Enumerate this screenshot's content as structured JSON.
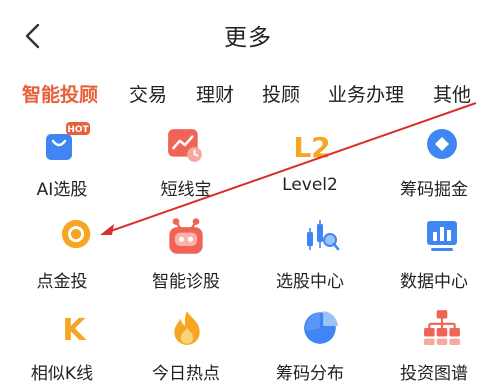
{
  "header": {
    "title": "更多",
    "back_icon": "chevron-left-icon"
  },
  "tabs": [
    {
      "label": "智能投顾",
      "active": true
    },
    {
      "label": "交易",
      "active": false
    },
    {
      "label": "理财",
      "active": false
    },
    {
      "label": "投顾",
      "active": false
    },
    {
      "label": "业务办理",
      "active": false
    },
    {
      "label": "其他",
      "active": false
    }
  ],
  "grid": [
    {
      "label": "AI选股",
      "icon": "shopping-bag-icon",
      "badge": "HOT"
    },
    {
      "label": "短线宝",
      "icon": "trend-chart-clock-icon"
    },
    {
      "label": "Level2",
      "icon": "level2-icon",
      "icon_text": "L2"
    },
    {
      "label": "筹码掘金",
      "icon": "blue-diamond-circle-icon"
    },
    {
      "label": "点金投",
      "icon": "gold-coin-icon"
    },
    {
      "label": "智能诊股",
      "icon": "robot-icon"
    },
    {
      "label": "选股中心",
      "icon": "candlestick-search-icon"
    },
    {
      "label": "数据中心",
      "icon": "data-chart-icon"
    },
    {
      "label": "相似K线",
      "icon": "k-letter-icon",
      "icon_text": "K"
    },
    {
      "label": "今日热点",
      "icon": "flame-icon"
    },
    {
      "label": "筹码分布",
      "icon": "pie-chart-icon"
    },
    {
      "label": "投资图谱",
      "icon": "org-chart-icon"
    }
  ],
  "colors": {
    "accent": "#e7603a",
    "blue": "#3f86f2",
    "orange": "#f5a623",
    "red": "#ef6456",
    "annotation_arrow": "#d9302c"
  }
}
